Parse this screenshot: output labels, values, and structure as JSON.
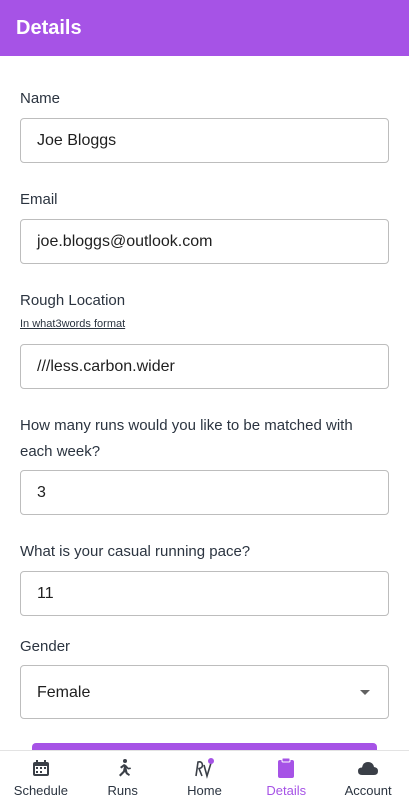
{
  "header": {
    "title": "Details"
  },
  "form": {
    "name": {
      "label": "Name",
      "value": "Joe Bloggs"
    },
    "email": {
      "label": "Email",
      "value": "joe.bloggs@outlook.com"
    },
    "location": {
      "label": "Rough Location",
      "hint": "In what3words format",
      "value": "///less.carbon.wider"
    },
    "runs": {
      "label_line1": "How many runs would you like to be matched with",
      "label_line2": "each week?",
      "value": "3"
    },
    "pace": {
      "label": "What is your casual running pace?",
      "value": "11"
    },
    "gender": {
      "label": "Gender",
      "value": "Female"
    }
  },
  "nav": {
    "items": [
      {
        "label": "Schedule",
        "icon": "calendar-icon"
      },
      {
        "label": "Runs",
        "icon": "runner-icon"
      },
      {
        "label": "Home",
        "icon": "rv-logo-icon"
      },
      {
        "label": "Details",
        "icon": "clipboard-icon",
        "active": true
      },
      {
        "label": "Account",
        "icon": "cloud-icon"
      }
    ]
  },
  "colors": {
    "accent": "#a653e6",
    "text": "#2b3440",
    "border": "#bdbdbd"
  }
}
